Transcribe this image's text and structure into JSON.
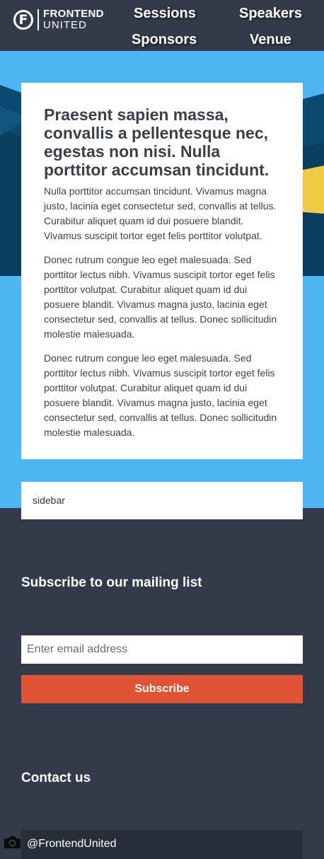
{
  "header": {
    "logo": {
      "top": "FRONTEND",
      "bottom": "UNITED",
      "mark": "F"
    },
    "nav": [
      {
        "label": "Sessions"
      },
      {
        "label": "Speakers"
      },
      {
        "label": "Sponsors"
      },
      {
        "label": "Venue"
      }
    ]
  },
  "article": {
    "title": "Praesent sapien massa, convallis a pellentesque nec, egestas non nisi. Nulla porttitor accumsan tincidunt.",
    "paragraphs": [
      "Nulla porttitor accumsan tincidunt. Vivamus magna justo, lacinia eget consectetur sed, convallis at tellus. Curabitur aliquet quam id dui posuere blandit. Vivamus suscipit tortor eget felis porttitor volutpat.",
      "Donec rutrum congue leo eget malesuada. Sed porttitor lectus nibh. Vivamus suscipit tortor eget felis porttitor volutpat. Curabitur aliquet quam id dui posuere blandit. Vivamus magna justo, lacinia eget consectetur sed, convallis at tellus. Donec sollicitudin molestie malesuada.",
      "Donec rutrum congue leo eget malesuada. Sed porttitor lectus nibh. Vivamus suscipit tortor eget felis porttitor volutpat. Curabitur aliquet quam id dui posuere blandit. Vivamus magna justo, lacinia eget consectetur sed, convallis at tellus. Donec sollicitudin molestie malesuada."
    ]
  },
  "sidebar": {
    "label": "sidebar"
  },
  "footer": {
    "subscribe": {
      "heading": "Subscribe to our mailing list",
      "email_placeholder": "Enter email address",
      "email_value": "",
      "button_label": "Subscribe"
    },
    "contact": {
      "heading": "Contact us",
      "twitter_handle": "@FrontendUnited",
      "icon": "camera-icon"
    }
  },
  "colors": {
    "header_bg": "#333b4a",
    "hero_sky": "#4db5f2",
    "hero_dark": "#0a3e5e",
    "hero_accent": "#f0cc42",
    "button": "#e05335",
    "input_dark": "#272d39"
  }
}
